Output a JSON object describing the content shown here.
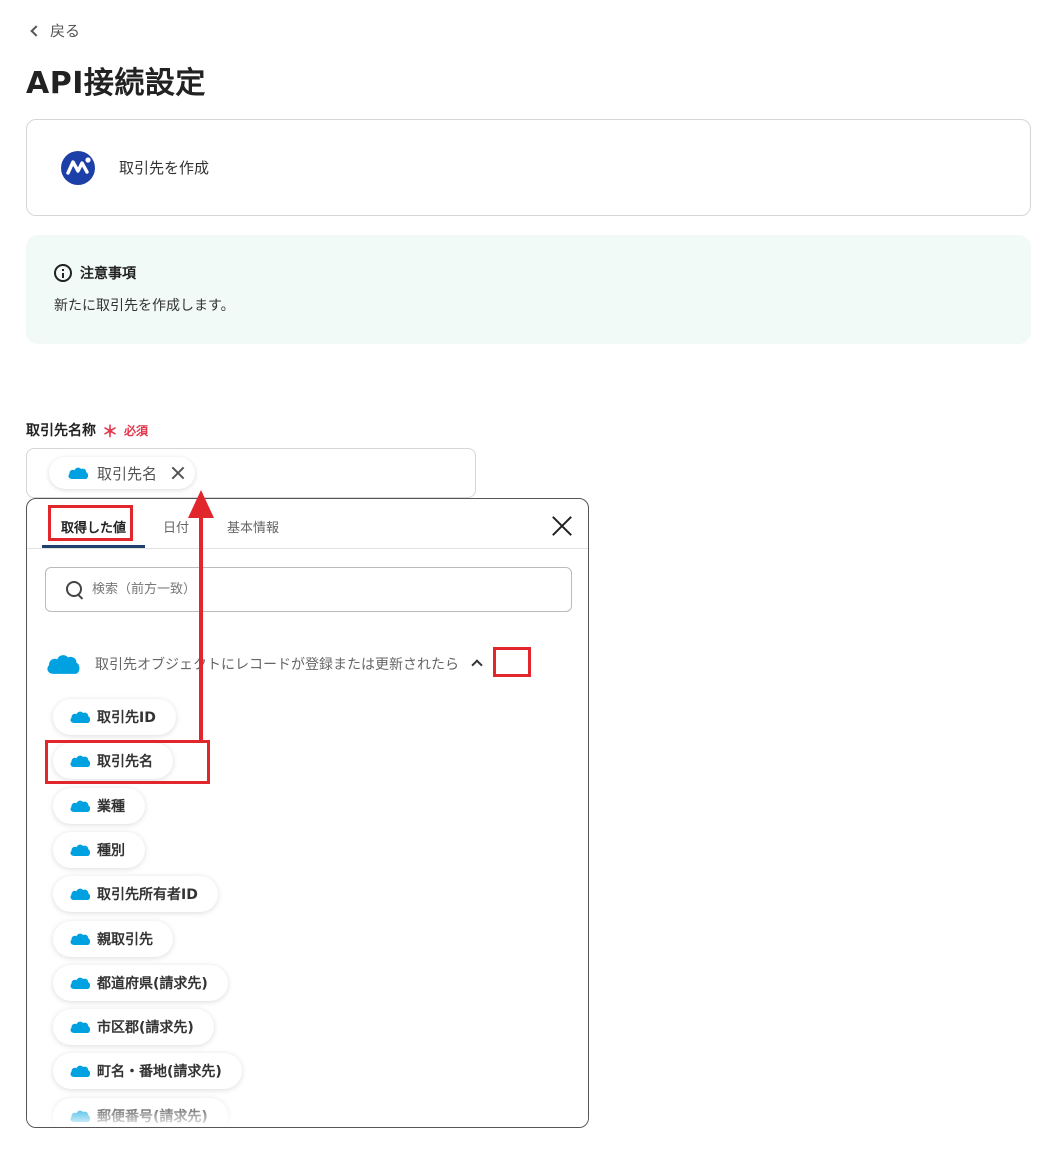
{
  "nav": {
    "back_label": "戻る"
  },
  "page": {
    "title": "API接続設定"
  },
  "app_card": {
    "action": "取引先を作成"
  },
  "notice": {
    "heading": "注意事項",
    "body": "新たに取引先を作成します。"
  },
  "field": {
    "label": "取引先名称",
    "required_mark": "＊",
    "required_label": "必須",
    "chip_value": "取引先名"
  },
  "popup": {
    "tabs": [
      "取得した値",
      "日付",
      "基本情報"
    ],
    "search_placeholder": "検索（前方一致）",
    "group_title": "取引先オブジェクトにレコードが登録または更新されたら",
    "items": [
      "取引先ID",
      "取引先名",
      "業種",
      "種別",
      "取引先所有者ID",
      "親取引先",
      "都道府県(請求先)",
      "市区郡(請求先)",
      "町名・番地(請求先)",
      "郵便番号(請求先)"
    ]
  },
  "colors": {
    "salesforce_blue": "#00a1e0",
    "highlight_red": "#e1262c",
    "required_red": "#e2364b",
    "notice_bg": "#f2faf8"
  }
}
